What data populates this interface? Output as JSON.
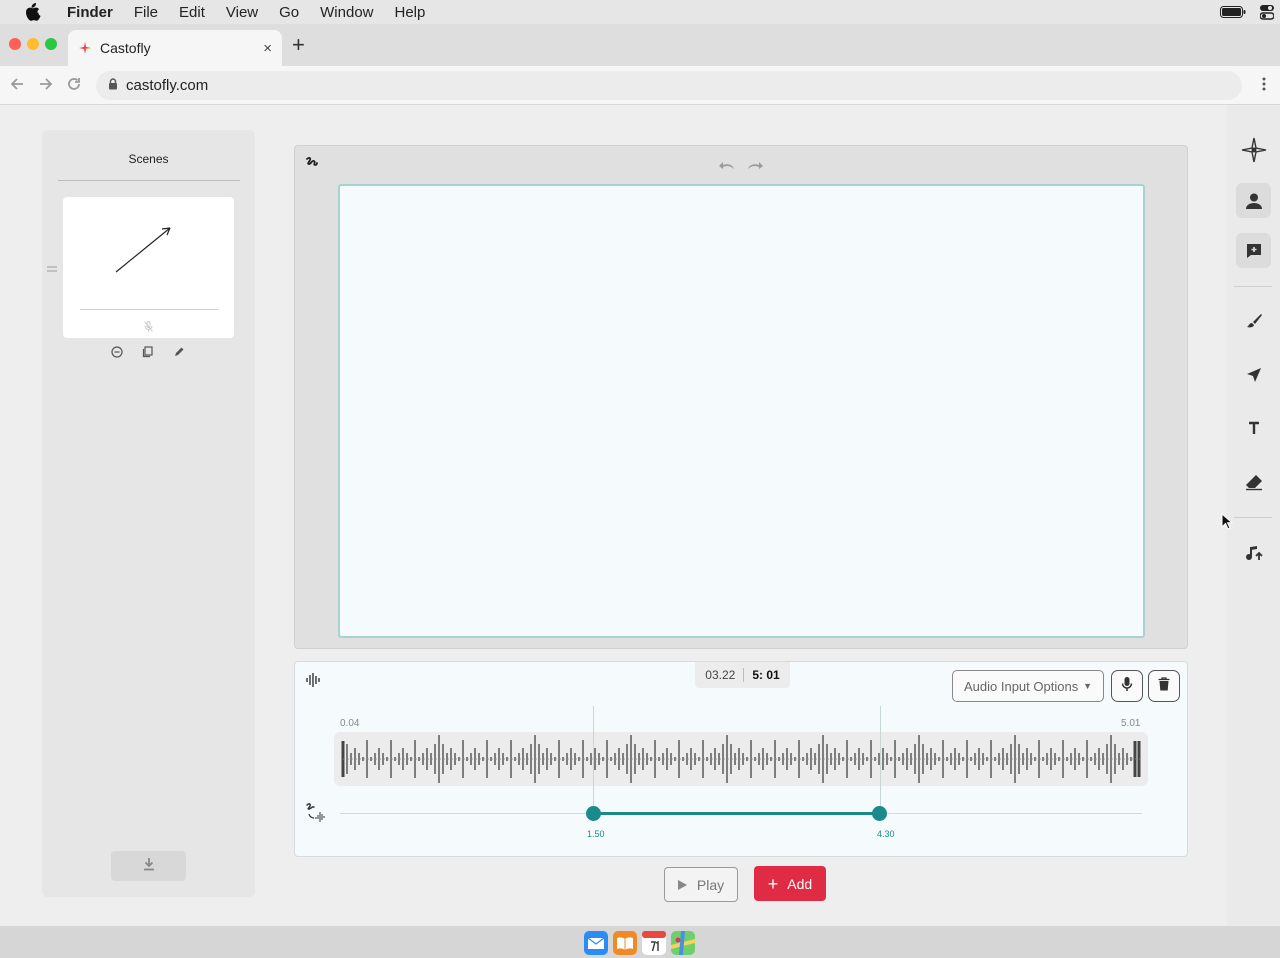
{
  "menubar": {
    "app_name": "Finder",
    "items": [
      "File",
      "Edit",
      "View",
      "Go",
      "Window",
      "Help"
    ]
  },
  "browser": {
    "tab_title": "Castofly",
    "tab_close": "×",
    "new_tab": "+",
    "url": "castofly.com"
  },
  "scenes": {
    "title": "Scenes"
  },
  "audio": {
    "current_time": "03.22",
    "total_time": "5: 01",
    "input_select": "Audio Input Options",
    "wave_start": "0.04",
    "wave_end": "5.01",
    "trim_start": "1.50",
    "trim_end": "4.30",
    "trim_start_fraction": 0.316,
    "trim_end_fraction": 0.673
  },
  "controls": {
    "play_label": "Play",
    "add_label": "Add"
  },
  "colors": {
    "accent_teal": "#1a8a8a",
    "add_red": "#e02b45",
    "canvas_border": "#a9d3d3"
  },
  "icons": {
    "toolbar": [
      "castofly-logo-icon",
      "avatar-icon",
      "comment-icon",
      "brush-icon",
      "pointer-icon",
      "text-icon",
      "eraser-icon",
      "music-icon"
    ]
  }
}
